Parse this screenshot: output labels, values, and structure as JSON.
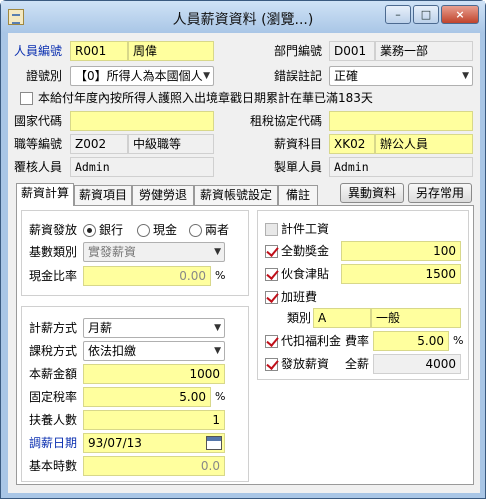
{
  "window": {
    "title": "人員薪資資料 (瀏覽...)",
    "min": "–",
    "max": "□",
    "close": "×"
  },
  "header": {
    "emp_no_label": "人員編號",
    "emp_no": "R001",
    "emp_name": "周偉",
    "dept_label": "部門編號",
    "dept_no": "D001",
    "dept_name": "業務一部",
    "id_type_label": "證號別",
    "id_type": "【0】所得人為本國個人",
    "error_label": "錯誤註記",
    "error_value": "正確",
    "accum_label": "本給付年度內按所得人護照入出境章戳日期累計在華已滿183天",
    "country_label": "國家代碼",
    "country": "",
    "tax_treaty_label": "租稅協定代碼",
    "tax_treaty": "",
    "grade_label": "職等編號",
    "grade_no": "Z002",
    "grade_name": "中級職等",
    "salary_item_label": "薪資科目",
    "salary_item_no": "XK02",
    "salary_item_name": "辦公人員",
    "reviewer_label": "覆核人員",
    "reviewer": "Admin",
    "creator_label": "製單人員",
    "creator": "Admin"
  },
  "tabs": [
    "薪資計算",
    "薪資項目",
    "勞健勞退",
    "薪資帳號設定",
    "備註"
  ],
  "buttons": {
    "change": "異動資料",
    "save_common": "另存常用"
  },
  "left": {
    "pay_method_label": "薪資發放",
    "pay_bank": "銀行",
    "pay_cash": "現金",
    "pay_both": "兩者",
    "base_type_label": "基數類別",
    "base_type": "實發薪資",
    "cash_ratio_label": "現金比率",
    "cash_ratio": "0.00",
    "cash_ratio_unit": "%",
    "calc_method_label": "計薪方式",
    "calc_method": "月薪",
    "tax_method_label": "課稅方式",
    "tax_method": "依法扣繳",
    "base_salary_label": "本薪金額",
    "base_salary": "1000",
    "fixed_tax_label": "固定稅率",
    "fixed_tax": "5.00",
    "fixed_tax_unit": "%",
    "dependents_label": "扶養人數",
    "dependents": "1",
    "adjust_date_label": "調薪日期",
    "adjust_date": "93/07/13",
    "base_hours_label": "基本時數",
    "base_hours": "0.0"
  },
  "right": {
    "piece_label": "計件工資",
    "attendance_label": "全勤獎金",
    "attendance": "100",
    "meal_label": "伙食津貼",
    "meal": "1500",
    "overtime_label": "加班費",
    "ot_type_label": "類別",
    "ot_type_code": "A",
    "ot_type_name": "一般",
    "welfare_label": "代扣福利金",
    "welfare_rate_label": "費率",
    "welfare_rate": "5.00",
    "welfare_unit": "%",
    "pay_salary_label": "發放薪資",
    "full_salary_label": "全薪",
    "full_salary": "4000"
  }
}
